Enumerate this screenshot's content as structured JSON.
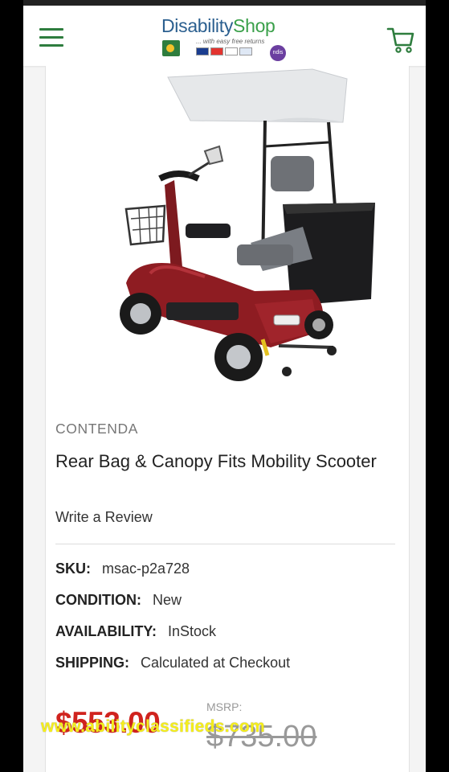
{
  "header": {
    "logo_title_part1": "Disability",
    "logo_title_part2": "Shop",
    "logo_tagline": "... with easy free returns",
    "logo_badge": "ndis"
  },
  "product": {
    "brand": "CONTENDA",
    "title": "Rear Bag & Canopy Fits Mobility Scooter",
    "review_link": "Write a Review",
    "specs": {
      "sku_label": "SKU:",
      "sku_value": "msac-p2a728",
      "condition_label": "CONDITION:",
      "condition_value": "New",
      "availability_label": "AVAILABILITY:",
      "availability_value": "InStock",
      "shipping_label": "SHIPPING:",
      "shipping_value": "Calculated at Checkout"
    },
    "price": "$553.00",
    "msrp_label": "MSRP:",
    "msrp_price": "$735.00"
  },
  "watermark": "www.abilityclassifieds.com",
  "colors": {
    "brand_green": "#2e7d3e",
    "brand_blue": "#2b5f8f",
    "price_red": "#d0231e",
    "scooter_red": "#8e1c22"
  },
  "icons": {
    "menu": "hamburger-menu-icon",
    "cart": "shopping-cart-icon"
  }
}
